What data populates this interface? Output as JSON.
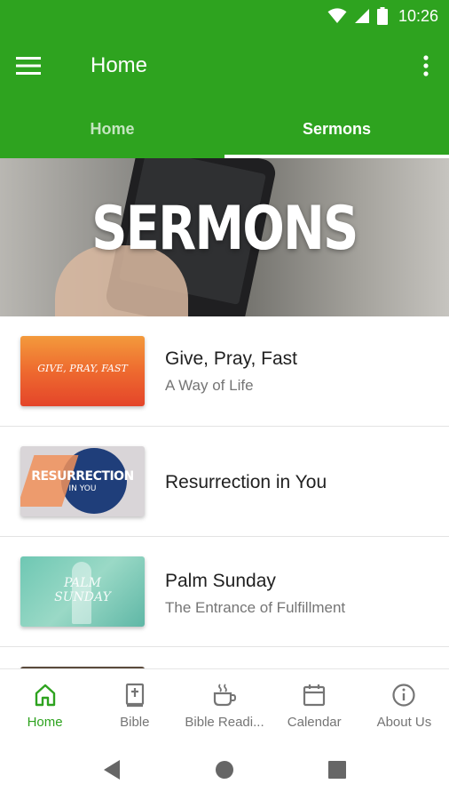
{
  "status": {
    "time": "10:26"
  },
  "app_bar": {
    "title": "Home"
  },
  "tabs": [
    {
      "label": "Home",
      "active": false
    },
    {
      "label": "Sermons",
      "active": true
    }
  ],
  "banner": {
    "title": "SERMONS"
  },
  "sermons": [
    {
      "title": "Give, Pray, Fast",
      "subtitle": "A Way of Life",
      "thumb_text": "GIVE, PRAY, FAST"
    },
    {
      "title": "Resurrection in You",
      "subtitle": "",
      "thumb_text": "RESURRECTION",
      "thumb_subtext": "IN YOU"
    },
    {
      "title": "Palm Sunday",
      "subtitle": "The Entrance of Fulfillment",
      "thumb_text": "PALM",
      "thumb_subtext": "SUNDAY"
    }
  ],
  "bottom_nav": [
    {
      "label": "Home",
      "icon": "home-icon",
      "active": true
    },
    {
      "label": "Bible",
      "icon": "bible-icon",
      "active": false
    },
    {
      "label": "Bible Readi...",
      "icon": "coffee-cup-icon",
      "active": false
    },
    {
      "label": "Calendar",
      "icon": "calendar-icon",
      "active": false
    },
    {
      "label": "About Us",
      "icon": "info-icon",
      "active": false
    }
  ],
  "colors": {
    "primary": "#2ea31f",
    "text_primary": "#212121",
    "text_secondary": "#757575"
  }
}
